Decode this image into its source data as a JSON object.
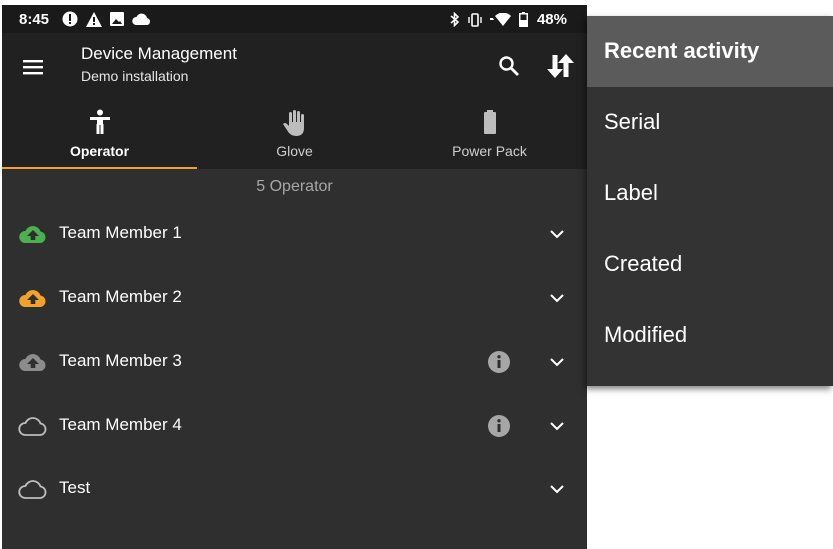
{
  "status_bar": {
    "time": "8:45",
    "battery_percent": "48%",
    "left_icons": [
      "alert-circle-icon",
      "warning-icon",
      "image-icon",
      "cloud-icon"
    ],
    "right_icons": [
      "bluetooth-icon",
      "vibrate-icon",
      "wifi-icon",
      "battery-icon"
    ]
  },
  "app_bar": {
    "title": "Device Management",
    "subtitle": "Demo installation",
    "icons": [
      "menu-icon",
      "search-icon",
      "sort-icon"
    ]
  },
  "tabs": [
    {
      "label": "Operator",
      "icon": "person-icon",
      "active": true
    },
    {
      "label": "Glove",
      "icon": "hand-icon",
      "active": false
    },
    {
      "label": "Power Pack",
      "icon": "battery-icon",
      "active": false
    }
  ],
  "list": {
    "count_label": "5 Operator",
    "items": [
      {
        "name": "Team Member 1",
        "status_icon": "cloud-upload-icon",
        "status_color": "#4caf50",
        "info": false
      },
      {
        "name": "Team Member 2",
        "status_icon": "cloud-upload-icon",
        "status_color": "#f0a32a",
        "info": false
      },
      {
        "name": "Team Member 3",
        "status_icon": "cloud-upload-icon",
        "status_color": "#8c8c8c",
        "info": true
      },
      {
        "name": "Team Member 4",
        "status_icon": "cloud-outline-icon",
        "status_color": "#bdbdbd",
        "info": true
      },
      {
        "name": "Test",
        "status_icon": "cloud-outline-icon",
        "status_color": "#bdbdbd",
        "info": false
      }
    ]
  },
  "sort_menu": {
    "items": [
      "Recent activity",
      "Serial",
      "Label",
      "Created",
      "Modified"
    ],
    "selected": "Recent activity"
  },
  "colors": {
    "accent": "#f0a32a",
    "background": "#2f2f2f",
    "app_bar": "#212121",
    "menu_selected": "#5b5b5b"
  }
}
